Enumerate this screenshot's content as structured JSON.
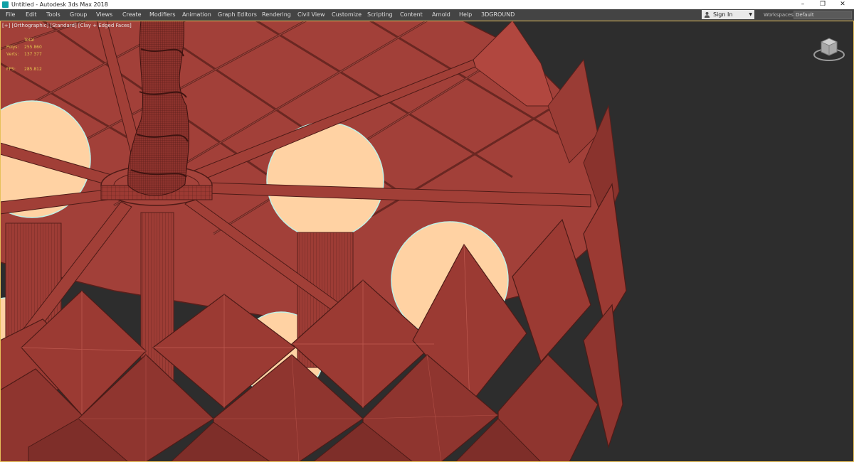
{
  "window": {
    "title": "Untitled - Autodesk 3ds Max 2018",
    "controls": {
      "minimize": "–",
      "restore": "❐",
      "close": "✕"
    }
  },
  "menu": {
    "items": [
      "File",
      "Edit",
      "Tools",
      "Group",
      "Views",
      "Create",
      "Modifiers",
      "Animation",
      "Graph Editors",
      "Rendering",
      "Civil View",
      "Customize",
      "Scripting",
      "Content",
      "Arnold",
      "Help",
      "3DGROUND"
    ],
    "sign_in": "Sign In",
    "workspaces_label": "Workspaces:",
    "workspaces_value": "Default"
  },
  "viewport": {
    "label": "[+] [Orthographic] [Standard] [Clay + Edged Faces]",
    "stats": {
      "total_label": "Total",
      "polys_label": "Polys:",
      "polys_value": "255 860",
      "verts_label": "Verts:",
      "verts_value": "137 377",
      "fps_label": "FPS:",
      "fps_value": "285.812"
    }
  },
  "colors": {
    "model_red": "#9c3a33",
    "model_dark": "#5a1f1b",
    "bulb": "#ffd2a3",
    "bulb_edge": "#bff0e6",
    "viewport_bg": "#2d2d2d",
    "stat_yellow": "#e3c44f",
    "active_border": "#e8c15a"
  }
}
